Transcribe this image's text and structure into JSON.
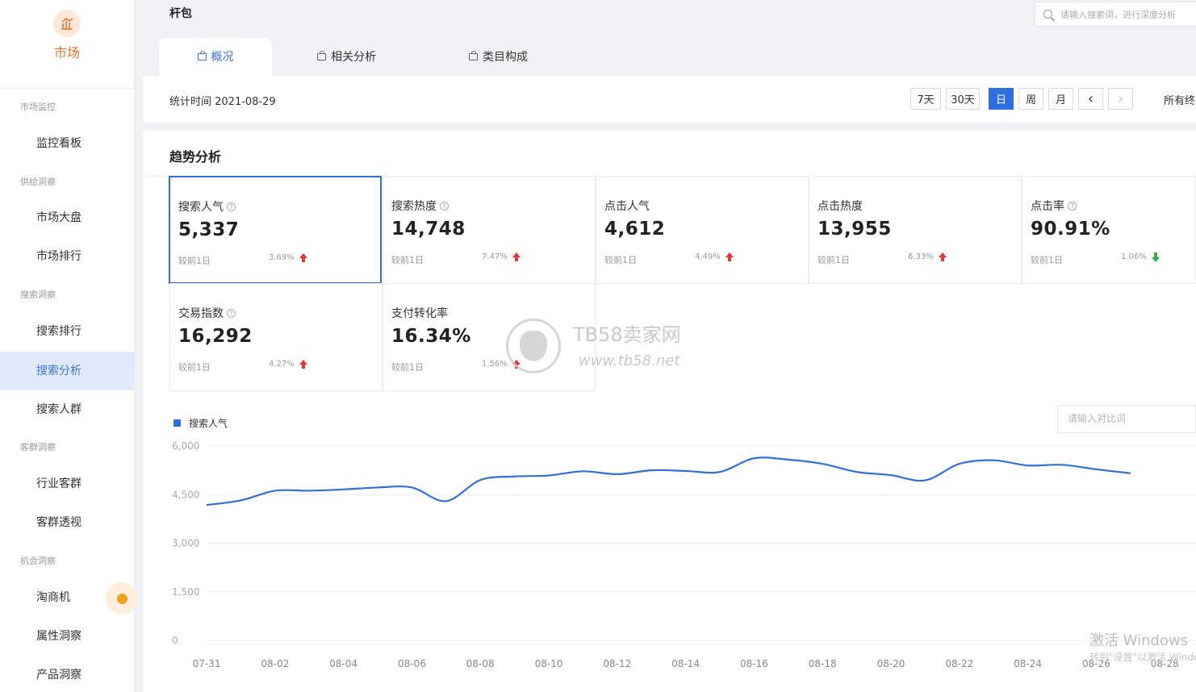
{
  "sidebar": {
    "brand_icon": "market-chart-icon",
    "brand_label": "市场",
    "groups": [
      {
        "label": "市场监控",
        "items": [
          {
            "label": "监控看板"
          }
        ]
      },
      {
        "label": "供给洞察",
        "items": [
          {
            "label": "市场大盘"
          },
          {
            "label": "市场排行"
          }
        ]
      },
      {
        "label": "搜索洞察",
        "items": [
          {
            "label": "搜索排行"
          },
          {
            "label": "搜索分析",
            "active": true
          },
          {
            "label": "搜索人群"
          }
        ]
      },
      {
        "label": "客群洞察",
        "items": [
          {
            "label": "行业客群"
          },
          {
            "label": "客群透视"
          }
        ]
      },
      {
        "label": "机会洞察",
        "items": [
          {
            "label": "淘商机"
          },
          {
            "label": "属性洞察"
          },
          {
            "label": "产品洞察"
          }
        ]
      }
    ]
  },
  "header": {
    "title": "杆包",
    "search_placeholder": "请输入搜索词，进行深度分析",
    "tabs": [
      {
        "label": "概况",
        "active": true
      },
      {
        "label": "相关分析"
      },
      {
        "label": "类目构成"
      }
    ]
  },
  "timebar": {
    "stat_time": "统计时间 2021-08-29",
    "buttons": [
      "7天",
      "30天",
      "日",
      "周",
      "月"
    ],
    "active_button": "日",
    "prev": "‹",
    "next": "›",
    "scope": "所有终端"
  },
  "trend": {
    "title": "趋势分析",
    "compare_label": "较前1日",
    "cards": [
      {
        "label": "搜索人气",
        "help": "?",
        "value": "5,337",
        "pct": "3.69%",
        "dir": "up",
        "selected": true
      },
      {
        "label": "搜索热度",
        "help": "?",
        "value": "14,748",
        "pct": "7.47%",
        "dir": "up"
      },
      {
        "label": "点击人气",
        "help": "",
        "value": "4,612",
        "pct": "4.49%",
        "dir": "up"
      },
      {
        "label": "点击热度",
        "help": "",
        "value": "13,955",
        "pct": "6.33%",
        "dir": "up"
      },
      {
        "label": "点击率",
        "help": "?",
        "value": "90.91%",
        "pct": "1.06%",
        "dir": "down"
      },
      {
        "label": "交易指数",
        "help": "?",
        "value": "16,292",
        "pct": "4.27%",
        "dir": "up"
      },
      {
        "label": "支付转化率",
        "help": "",
        "value": "16.34%",
        "pct": "1.56%",
        "dir": "up"
      }
    ],
    "legend": "搜索人气",
    "compare_placeholder": "请输入对比词"
  },
  "colors": {
    "accent": "#2f6fe0",
    "brand": "#e8742c",
    "up": "#e23a3a",
    "down": "#2fae4a"
  },
  "chart_data": {
    "type": "line",
    "x": [
      "07-31",
      "08-01",
      "08-02",
      "08-03",
      "08-04",
      "08-05",
      "08-06",
      "08-07",
      "08-08",
      "08-09",
      "08-10",
      "08-11",
      "08-12",
      "08-13",
      "08-14",
      "08-15",
      "08-16",
      "08-17",
      "08-18",
      "08-19",
      "08-20",
      "08-21",
      "08-22",
      "08-23",
      "08-24",
      "08-25",
      "08-26",
      "08-27"
    ],
    "xticks": [
      "07-31",
      "08-02",
      "08-04",
      "08-06",
      "08-08",
      "08-10",
      "08-12",
      "08-14",
      "08-16",
      "08-18",
      "08-20",
      "08-22",
      "08-24",
      "08-26",
      "08-28"
    ],
    "series": [
      {
        "name": "搜索人气",
        "values": [
          4180,
          4320,
          4620,
          4620,
          4660,
          4720,
          4720,
          4300,
          4950,
          5060,
          5090,
          5220,
          5130,
          5250,
          5230,
          5200,
          5620,
          5580,
          5450,
          5200,
          5100,
          4940,
          5450,
          5560,
          5400,
          5420,
          5280,
          5160
        ]
      }
    ],
    "ylim": [
      0,
      6000
    ],
    "yticks": [
      0,
      1500,
      3000,
      4500,
      6000
    ],
    "ytick_labels": [
      "0",
      "1,500",
      "3,000",
      "4,500",
      "6,000"
    ],
    "grid": true,
    "legend": "top-left"
  },
  "watermark": {
    "brand": "TB58卖家网",
    "url": "www.tb58.net"
  },
  "os_notice": {
    "line1": "激活 Windows",
    "line2": "转到\"设置\"以激活 Windows。"
  }
}
